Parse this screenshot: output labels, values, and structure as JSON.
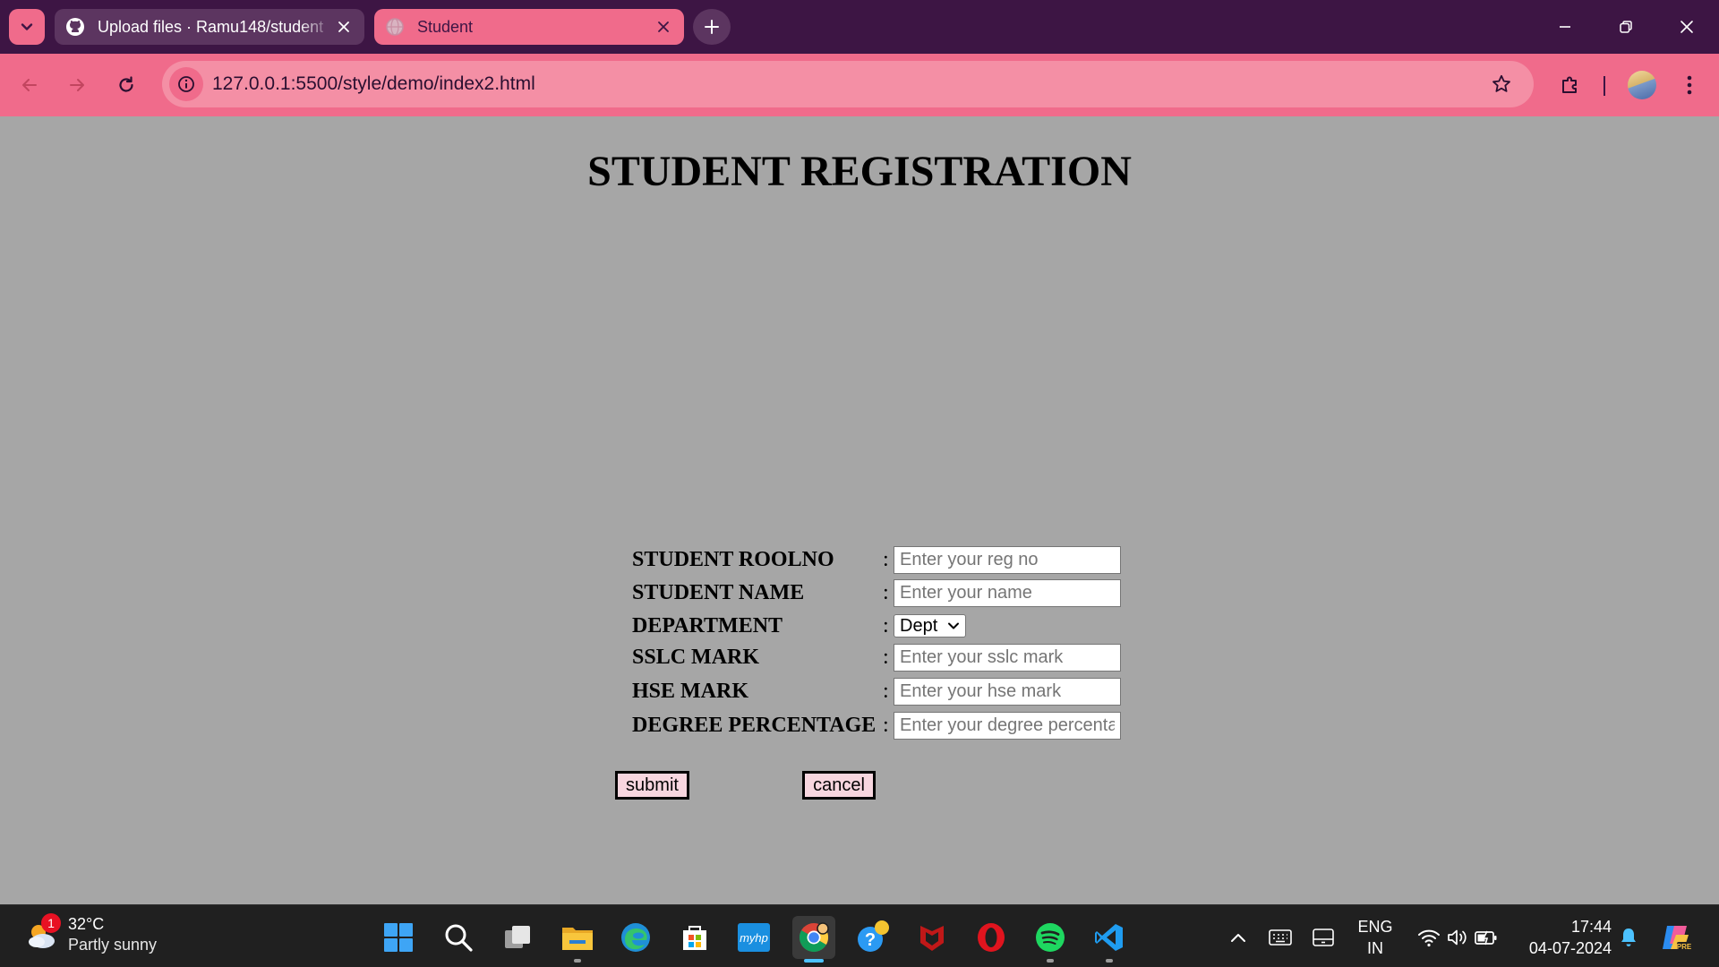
{
  "browser": {
    "tabs": [
      {
        "title": "Upload files · Ramu148/student",
        "active": false,
        "favicon": "github-icon"
      },
      {
        "title": "Student",
        "active": true,
        "favicon": "globe-icon"
      }
    ],
    "url": "127.0.0.1:5500/style/demo/index2.html",
    "theme_color": "#f06b8b",
    "frame_color": "#3d1544"
  },
  "page": {
    "title": "STUDENT REGISTRATION",
    "background": "#a6a6a6",
    "fields": [
      {
        "label": "STUDENT ROOLNO",
        "colon": ":",
        "type": "text",
        "placeholder": "Enter your reg no",
        "value": ""
      },
      {
        "label": "STUDENT NAME",
        "colon": ":",
        "type": "text",
        "placeholder": "Enter your name",
        "value": ""
      },
      {
        "label": "DEPARTMENT",
        "colon": ":",
        "type": "select",
        "selected": "Dept"
      },
      {
        "label": "SSLC MARK",
        "colon": ":",
        "type": "text",
        "placeholder": "Enter your sslc mark",
        "value": ""
      },
      {
        "label": "HSE MARK",
        "colon": ":",
        "type": "text",
        "placeholder": "Enter your hse mark",
        "value": ""
      },
      {
        "label": "DEGREE PERCENTAGE",
        "colon": ":",
        "type": "text",
        "placeholder": "Enter your degree percentage",
        "value": ""
      }
    ],
    "buttons": {
      "submit": "submit",
      "cancel": "cancel"
    }
  },
  "taskbar": {
    "weather": {
      "temp": "32°C",
      "condition": "Partly sunny",
      "badge": "1"
    },
    "apps": [
      {
        "name": "start-icon"
      },
      {
        "name": "search-icon"
      },
      {
        "name": "task-view-icon"
      },
      {
        "name": "file-explorer-icon"
      },
      {
        "name": "edge-icon"
      },
      {
        "name": "microsoft-store-icon"
      },
      {
        "name": "myhp-icon",
        "label": "myhp"
      },
      {
        "name": "chrome-icon",
        "active": true
      },
      {
        "name": "get-help-icon"
      },
      {
        "name": "mcafee-icon"
      },
      {
        "name": "opera-icon"
      },
      {
        "name": "spotify-icon"
      },
      {
        "name": "vscode-icon"
      }
    ],
    "language": {
      "line1": "ENG",
      "line2": "IN"
    },
    "clock": {
      "time": "17:44",
      "date": "04-07-2024"
    }
  }
}
